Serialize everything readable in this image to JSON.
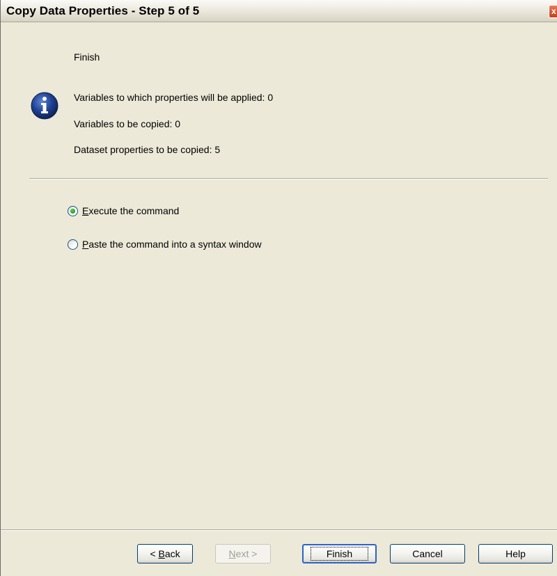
{
  "window": {
    "title": "Copy Data Properties - Step 5 of 5",
    "close_label": "x"
  },
  "summary": {
    "heading": "Finish",
    "icon": "info-icon",
    "line1": "Variables to which properties will be applied: 0",
    "line2": "Variables to be copied: 0",
    "line3": "Dataset properties to be copied: 5"
  },
  "options": {
    "execute": {
      "mnemonic": "E",
      "rest": "xecute the command",
      "selected": true
    },
    "paste": {
      "mnemonic": "P",
      "rest": "aste the command into a syntax window",
      "selected": false
    }
  },
  "buttons": {
    "back": {
      "prefix": "< ",
      "mnemonic": "B",
      "rest": "ack",
      "enabled": true
    },
    "next": {
      "mnemonic": "N",
      "rest": "ext",
      "suffix": " >",
      "enabled": false
    },
    "finish": {
      "label": "Finish",
      "enabled": true
    },
    "cancel": {
      "label": "Cancel",
      "enabled": true
    },
    "help": {
      "label": "Help",
      "enabled": true
    }
  },
  "colors": {
    "dialog_bg": "#ece9d8",
    "radio_selected": "#21a121",
    "info_icon_bg": "#1d3f8f",
    "button_border": "#003c74"
  }
}
